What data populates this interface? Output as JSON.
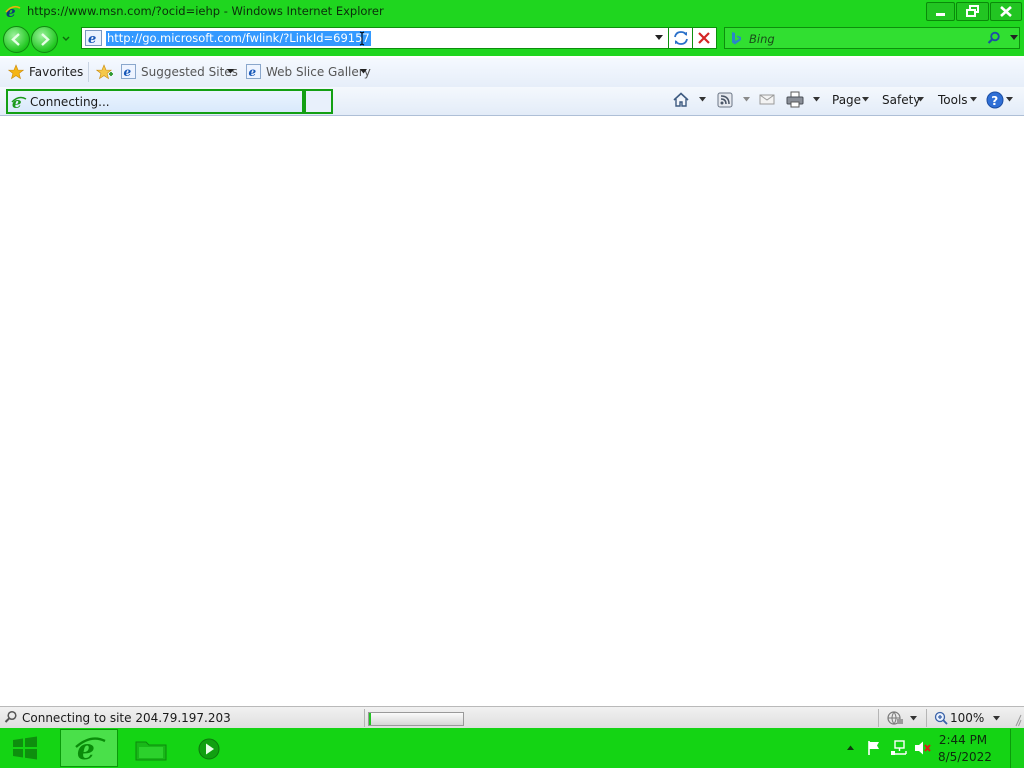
{
  "window": {
    "title": "https://www.msn.com/?ocid=iehp - Windows Internet Explorer"
  },
  "navigation": {
    "address_url": "http://go.microsoft.com/fwlink/?LinkId=69157",
    "search_placeholder": "Bing"
  },
  "favorites_bar": {
    "favorites_label": "Favorites",
    "items": [
      "Suggested Sites",
      "Web Slice Gallery"
    ]
  },
  "tab": {
    "label": "Connecting..."
  },
  "command_bar": {
    "page_label": "Page",
    "safety_label": "Safety",
    "tools_label": "Tools"
  },
  "status_bar": {
    "status_text": "Connecting to site 204.79.197.203",
    "progress_fraction": 0.02,
    "zoom": "100%"
  },
  "taskbar": {
    "time": "2:44 PM",
    "date": "8/5/2022"
  },
  "colors": {
    "chrome_green": "#1fd61f",
    "taskbar_green": "#14d414",
    "selection_blue": "#3399ff"
  },
  "icons": [
    "ie-icon",
    "minimize-icon",
    "restore-icon",
    "close-icon",
    "back-icon",
    "forward-icon",
    "refresh-icon",
    "stop-icon",
    "bing-icon",
    "search-icon",
    "star-icon",
    "add-favorite-icon",
    "home-icon",
    "feeds-icon",
    "mail-icon",
    "print-icon",
    "help-icon",
    "globe-icon",
    "zoom-icon",
    "start-icon",
    "folder-icon",
    "media-player-icon",
    "flag-icon",
    "network-icon",
    "volume-muted-icon"
  ]
}
